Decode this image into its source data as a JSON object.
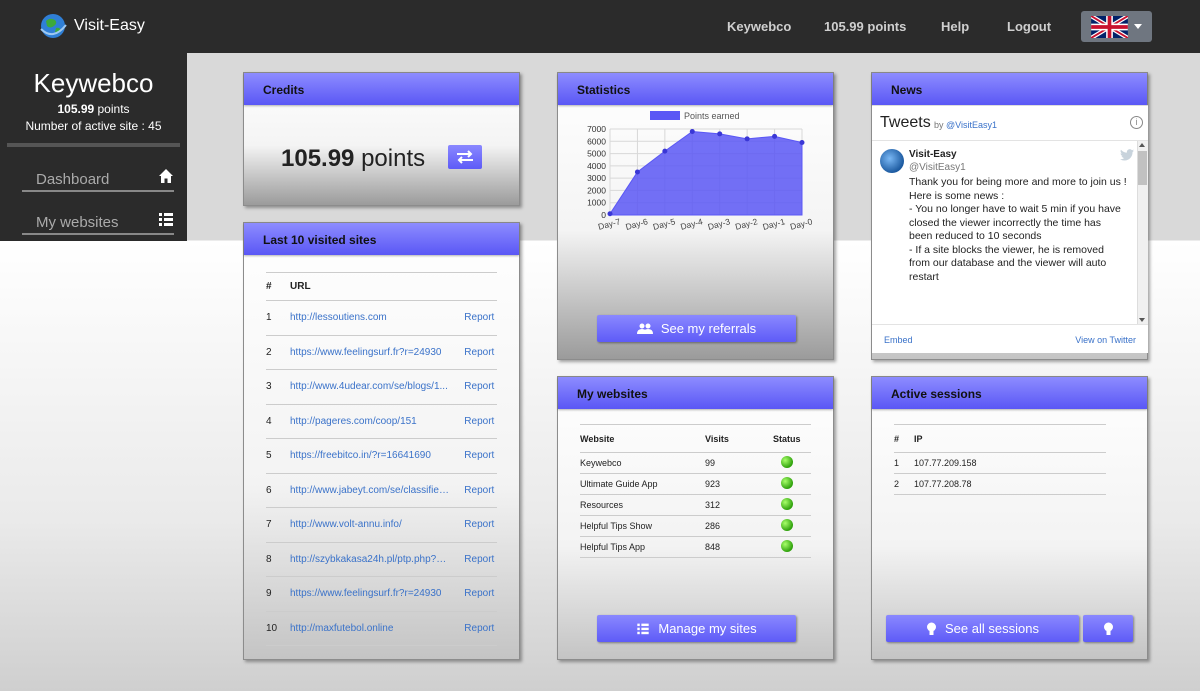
{
  "navbar": {
    "brand": "Visit-Easy",
    "links": {
      "user": "Keywebco",
      "points": "105.99 points",
      "help": "Help",
      "logout": "Logout"
    }
  },
  "sidebar": {
    "username": "Keywebco",
    "points_value": "105.99",
    "points_unit": " points",
    "active_sites": "Number of active site : 45",
    "items": [
      {
        "label": "Dashboard",
        "icon": "home-icon"
      },
      {
        "label": "My websites",
        "icon": "list-icon"
      }
    ]
  },
  "credits": {
    "title": "Credits",
    "amount": "105.99",
    "unit": " points"
  },
  "visited": {
    "title": "Last 10 visited sites",
    "headers": [
      "#",
      "URL",
      ""
    ],
    "rows": [
      {
        "n": "1",
        "url": "http://lessoutiens.com",
        "action": "Report"
      },
      {
        "n": "2",
        "url": "https://www.feelingsurf.fr?r=24930",
        "action": "Report"
      },
      {
        "n": "3",
        "url": "http://www.4udear.com/se/blogs/1...",
        "action": "Report"
      },
      {
        "n": "4",
        "url": "http://pageres.com/coop/151",
        "action": "Report"
      },
      {
        "n": "5",
        "url": "https://freebitco.in/?r=16641690",
        "action": "Report"
      },
      {
        "n": "6",
        "url": "http://www.jabeyt.com/se/classified...",
        "action": "Report"
      },
      {
        "n": "7",
        "url": "http://www.volt-annu.info/",
        "action": "Report"
      },
      {
        "n": "8",
        "url": "http://szybkakasa24h.pl/ptp.php?us...",
        "action": "Report"
      },
      {
        "n": "9",
        "url": "https://www.feelingsurf.fr?r=24930",
        "action": "Report"
      },
      {
        "n": "10",
        "url": "http://maxfutebol.online",
        "action": "Report"
      }
    ]
  },
  "statistics": {
    "title": "Statistics",
    "button": "See my referrals"
  },
  "chart_data": {
    "type": "area",
    "categories": [
      "Day-7",
      "Day-6",
      "Day-5",
      "Day-4",
      "Day-3",
      "Day-2",
      "Day-1",
      "Day-0"
    ],
    "series": [
      {
        "name": "Points earned",
        "values": [
          100,
          3500,
          5200,
          6800,
          6600,
          6200,
          6400,
          5900
        ]
      }
    ],
    "yticks": [
      0,
      1000,
      2000,
      3000,
      4000,
      5000,
      6000,
      7000
    ],
    "ylim": [
      0,
      7000
    ],
    "legend_position": "top",
    "grid": true,
    "color": "#5a57f5"
  },
  "news": {
    "title": "News",
    "tweets_title": "Tweets",
    "by": "by ",
    "by_handle": "@VisitEasy1",
    "tweet": {
      "name": "Visit-Easy",
      "handle": "@VisitEasy1",
      "text": "Thank you for being more and more to join us !\nHere is some news :\n- You no longer have to wait 5 min if you have closed the viewer incorrectly the time has been reduced to 10 seconds\n- If a site blocks the viewer, he is removed from our database and the viewer will auto restart"
    },
    "embed": "Embed",
    "view_on_twitter": "View on Twitter"
  },
  "my_websites": {
    "title": "My websites",
    "headers": [
      "Website",
      "Visits",
      "Status"
    ],
    "rows": [
      {
        "name": "Keywebco",
        "visits": "99"
      },
      {
        "name": "Ultimate Guide App",
        "visits": "923"
      },
      {
        "name": "Resources",
        "visits": "312"
      },
      {
        "name": "Helpful Tips Show",
        "visits": "286"
      },
      {
        "name": "Helpful Tips App",
        "visits": "848"
      }
    ],
    "button": "Manage my sites"
  },
  "sessions": {
    "title": "Active sessions",
    "headers": [
      "#",
      "IP"
    ],
    "rows": [
      {
        "n": "1",
        "ip": "107.77.209.158"
      },
      {
        "n": "2",
        "ip": "107.77.208.78"
      }
    ],
    "button": "See all sessions"
  }
}
